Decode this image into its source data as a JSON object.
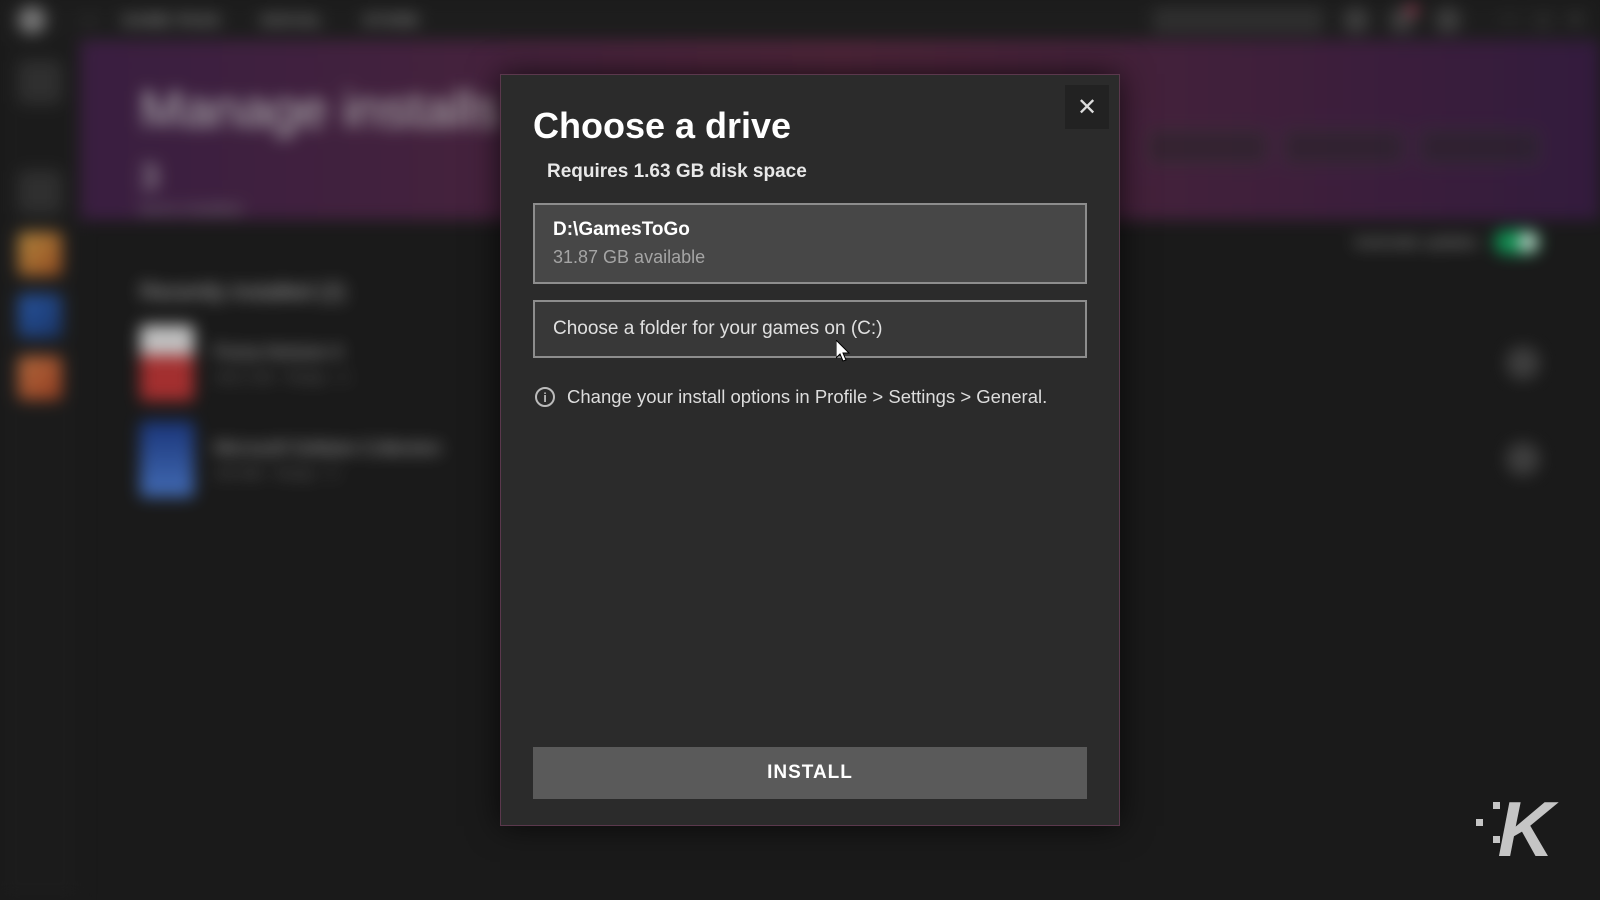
{
  "topnav": {
    "items": [
      "GAME PASS",
      "SOCIAL",
      "STORE"
    ],
    "search_placeholder": "Search for games"
  },
  "page": {
    "title": "Manage installs",
    "count": "3",
    "count_label": "items installed",
    "section_title": "Recently installed (2)",
    "actions": [
      "RESUME ALL",
      "PAUSE ALL",
      "UPDATE ALL"
    ],
    "auto_update_label": "Automatic updates"
  },
  "games": [
    {
      "name": "Forza Horizon 4",
      "sub": "105.2 GB · Ready · C:"
    },
    {
      "name": "Microsoft Solitaire Collection",
      "sub": "234 MB · Ready · C:"
    }
  ],
  "modal": {
    "title": "Choose a drive",
    "subtitle": "Requires 1.63 GB disk space",
    "drive_path": "D:\\GamesToGo",
    "drive_available": "31.87 GB available",
    "choose_folder": "Choose a folder for your games on (C:)",
    "info_text": "Change your install options in Profile > Settings > General.",
    "install_label": "INSTALL"
  },
  "watermark": {
    "letter": "K"
  }
}
